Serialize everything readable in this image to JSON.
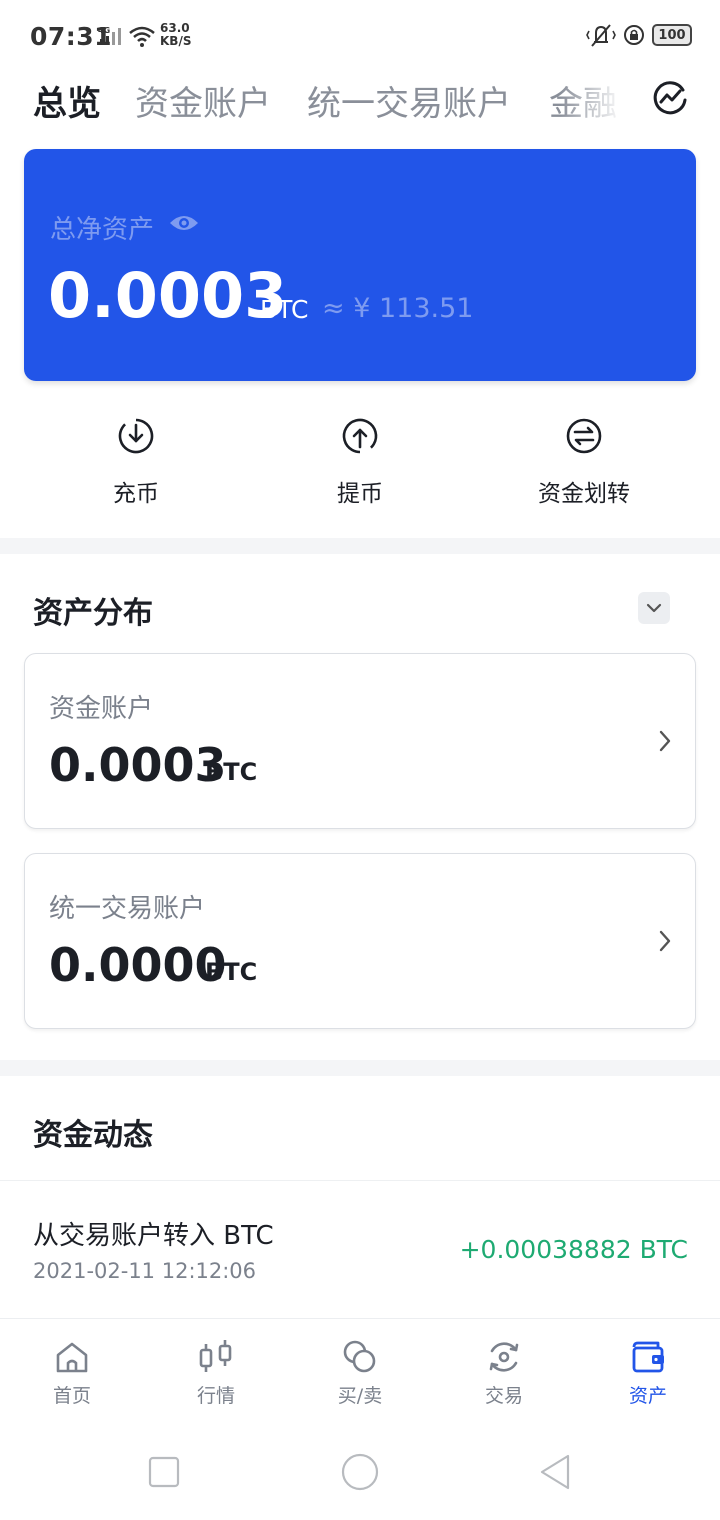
{
  "status_bar": {
    "time": "07:31",
    "network": "4G",
    "speed_value": "63.0",
    "speed_unit": "KB/S",
    "battery": "100"
  },
  "tabs": [
    {
      "label": "总览",
      "active": true
    },
    {
      "label": "资金账户",
      "active": false
    },
    {
      "label": "统一交易账户",
      "active": false
    },
    {
      "label": "金融",
      "active": false
    }
  ],
  "balance": {
    "label": "总净资产",
    "value": "0.0003",
    "unit": "BTC",
    "approx": "≈ ¥ 113.51"
  },
  "actions": [
    {
      "label": "充币",
      "icon": "deposit-icon"
    },
    {
      "label": "提币",
      "icon": "withdraw-icon"
    },
    {
      "label": "资金划转",
      "icon": "transfer-icon"
    }
  ],
  "distribution": {
    "title": "资产分布",
    "accounts": [
      {
        "name": "资金账户",
        "value": "0.0003",
        "unit": "BTC"
      },
      {
        "name": "统一交易账户",
        "value": "0.0000",
        "unit": "BTC"
      }
    ]
  },
  "activity": {
    "title": "资金动态",
    "items": [
      {
        "title": "从交易账户转入 BTC",
        "date": "2021-02-11 12:12:06",
        "amount": "+0.00038882 BTC"
      }
    ]
  },
  "bottom_nav": [
    {
      "label": "首页",
      "icon": "home-icon",
      "active": false
    },
    {
      "label": "行情",
      "icon": "candlestick-icon",
      "active": false
    },
    {
      "label": "买/卖",
      "icon": "coins-icon",
      "active": false
    },
    {
      "label": "交易",
      "icon": "trade-icon",
      "active": false
    },
    {
      "label": "资产",
      "icon": "wallet-icon",
      "active": true
    }
  ],
  "colors": {
    "accent": "#2255e8",
    "positive": "#1eaa72",
    "muted": "#7b818c"
  }
}
